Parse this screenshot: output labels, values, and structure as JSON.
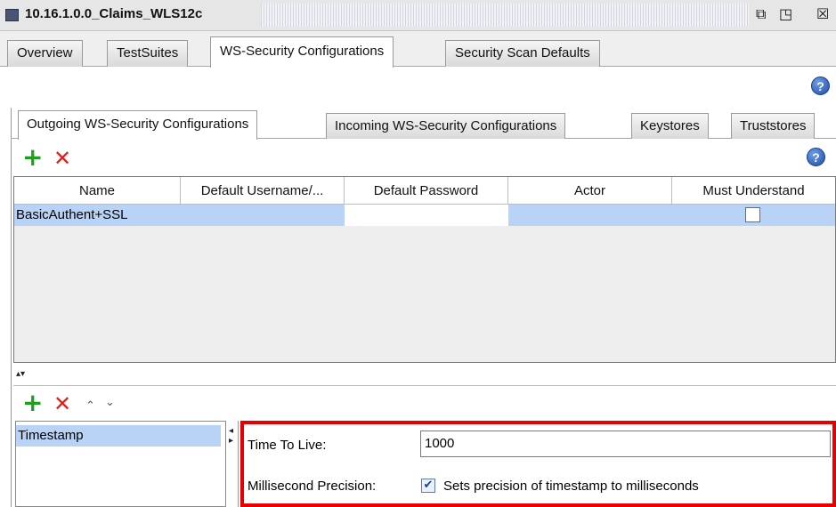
{
  "window": {
    "title": "10.16.1.0.0_Claims_WLS12c",
    "restore_icon": "restore-icon",
    "maximize_icon": "maximize-icon",
    "close_icon": "close-icon"
  },
  "main_tabs": [
    {
      "label": "Overview",
      "active": false
    },
    {
      "label": "TestSuites",
      "active": false
    },
    {
      "label": "WS-Security Configurations",
      "active": true
    },
    {
      "label": "Security Scan Defaults",
      "active": false
    }
  ],
  "help": {
    "glyph": "?"
  },
  "sub_tabs": [
    {
      "label": "Outgoing WS-Security Configurations",
      "active": true
    },
    {
      "label": "Incoming WS-Security Configurations",
      "active": false
    },
    {
      "label": "Keystores",
      "active": false
    },
    {
      "label": "Truststores",
      "active": false
    }
  ],
  "toolbar": {
    "add_glyph": "+",
    "remove_glyph": "✕"
  },
  "table": {
    "columns": [
      "Name",
      "Default Username/...",
      "Default Password",
      "Actor",
      "Must Understand"
    ],
    "rows": [
      {
        "name": "BasicAuthent+SSL",
        "username": "",
        "password": "",
        "actor": "",
        "must_understand": false
      }
    ]
  },
  "lower_toolbar": {
    "add_glyph": "+",
    "remove_glyph": "✕",
    "up_glyph": "⌃",
    "down_glyph": "⌄"
  },
  "entries": [
    "Timestamp"
  ],
  "form": {
    "ttl_label": "Time To Live:",
    "ttl_value": "1000",
    "precision_label": "Millisecond Precision:",
    "precision_checked": true,
    "precision_text": "Sets precision of timestamp to milliseconds"
  },
  "colors": {
    "accent_red": "#e60000",
    "selection": "#b8d3f5",
    "add_green": "#1ea01e",
    "remove_red": "#e0201a"
  }
}
